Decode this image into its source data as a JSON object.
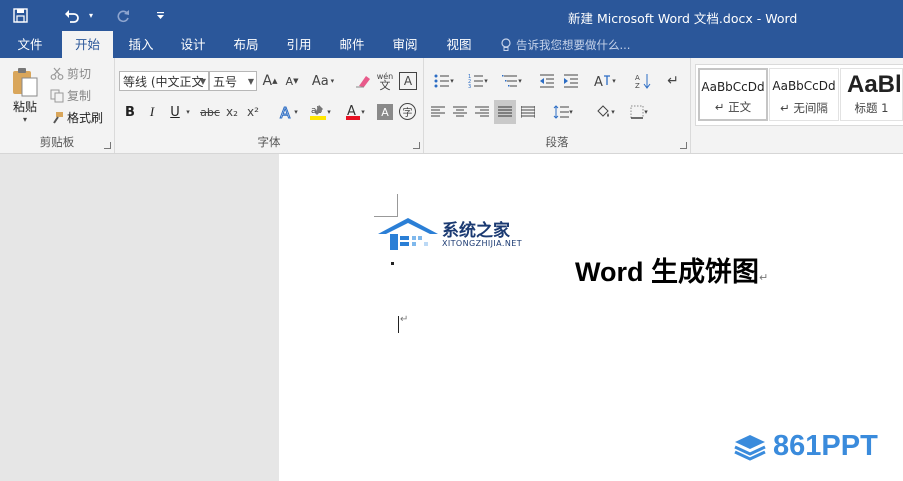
{
  "window": {
    "title": "新建 Microsoft Word 文档.docx - Word"
  },
  "qat": {
    "save_icon": "save-icon",
    "undo_icon": "undo-icon",
    "redo_icon": "redo-icon",
    "customize_icon": "customize-qat-icon"
  },
  "tabs": [
    {
      "label": "文件",
      "active": false
    },
    {
      "label": "开始",
      "active": true
    },
    {
      "label": "插入",
      "active": false
    },
    {
      "label": "设计",
      "active": false
    },
    {
      "label": "布局",
      "active": false
    },
    {
      "label": "引用",
      "active": false
    },
    {
      "label": "邮件",
      "active": false
    },
    {
      "label": "审阅",
      "active": false
    },
    {
      "label": "视图",
      "active": false
    }
  ],
  "tellme": {
    "placeholder": "告诉我您想要做什么..."
  },
  "clipboard": {
    "paste_label": "粘贴",
    "cut_label": "剪切",
    "copy_label": "复制",
    "format_painter_label": "格式刷",
    "group_label": "剪贴板"
  },
  "font": {
    "font_name": "等线 (中文正文",
    "font_size": "五号",
    "group_label": "字体",
    "change_case": "Aa",
    "bold": "B",
    "italic": "I",
    "underline": "U",
    "strike": "abc",
    "subscript": "x₂",
    "superscript": "x²",
    "grow": "A",
    "shrink": "A",
    "char_border": "A",
    "wen": "wén"
  },
  "paragraph": {
    "group_label": "段落"
  },
  "styles": {
    "items": [
      {
        "sample": "AaBbCcDd",
        "name": "↵ 正文",
        "selected": true
      },
      {
        "sample": "AaBbCcDd",
        "name": "↵ 无间隔",
        "selected": false
      },
      {
        "sample": "AaBl",
        "name": "标题 1",
        "selected": false
      }
    ]
  },
  "document": {
    "heading": "Word 生成饼图",
    "para_mark": "↵"
  },
  "watermarks": {
    "site_name": "系统之家",
    "site_pinyin": "XITONGZHIJIA.NET",
    "brand": "861PPT"
  },
  "colors": {
    "titlebar": "#2b579a",
    "ribbon": "#f3f3f3",
    "highlight": "#ffe600",
    "font_color": "#e81123",
    "brand_blue": "#3a8bdc"
  }
}
